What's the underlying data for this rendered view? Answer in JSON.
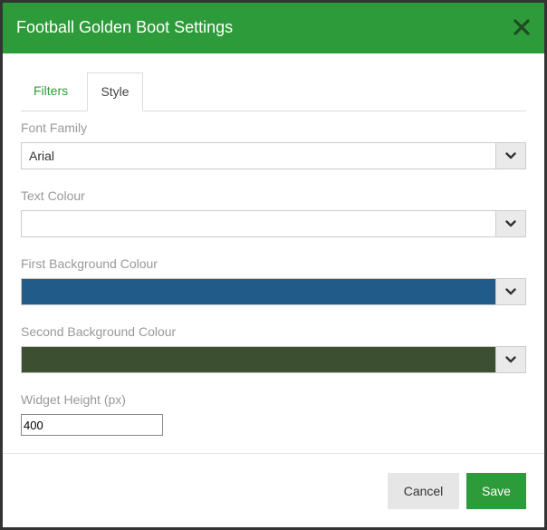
{
  "dialog": {
    "title": "Football Golden Boot Settings",
    "close_icon": "close-icon"
  },
  "tabs": [
    {
      "label": "Filters",
      "active": false
    },
    {
      "label": "Style",
      "active": true
    }
  ],
  "fields": {
    "font_family": {
      "label": "Font Family",
      "value": "Arial"
    },
    "text_colour": {
      "label": "Text Colour",
      "value": ""
    },
    "first_background_colour": {
      "label": "First Background Colour",
      "color": "#215b8a"
    },
    "second_background_colour": {
      "label": "Second Background Colour",
      "color": "#3c4f30"
    },
    "widget_height": {
      "label": "Widget Height (px)",
      "value": "400"
    }
  },
  "buttons": {
    "cancel_label": "Cancel",
    "save_label": "Save"
  },
  "colors": {
    "accent": "#2e9b3a",
    "tab_inactive_text": "#2e9b3a",
    "label_text": "#999999"
  }
}
